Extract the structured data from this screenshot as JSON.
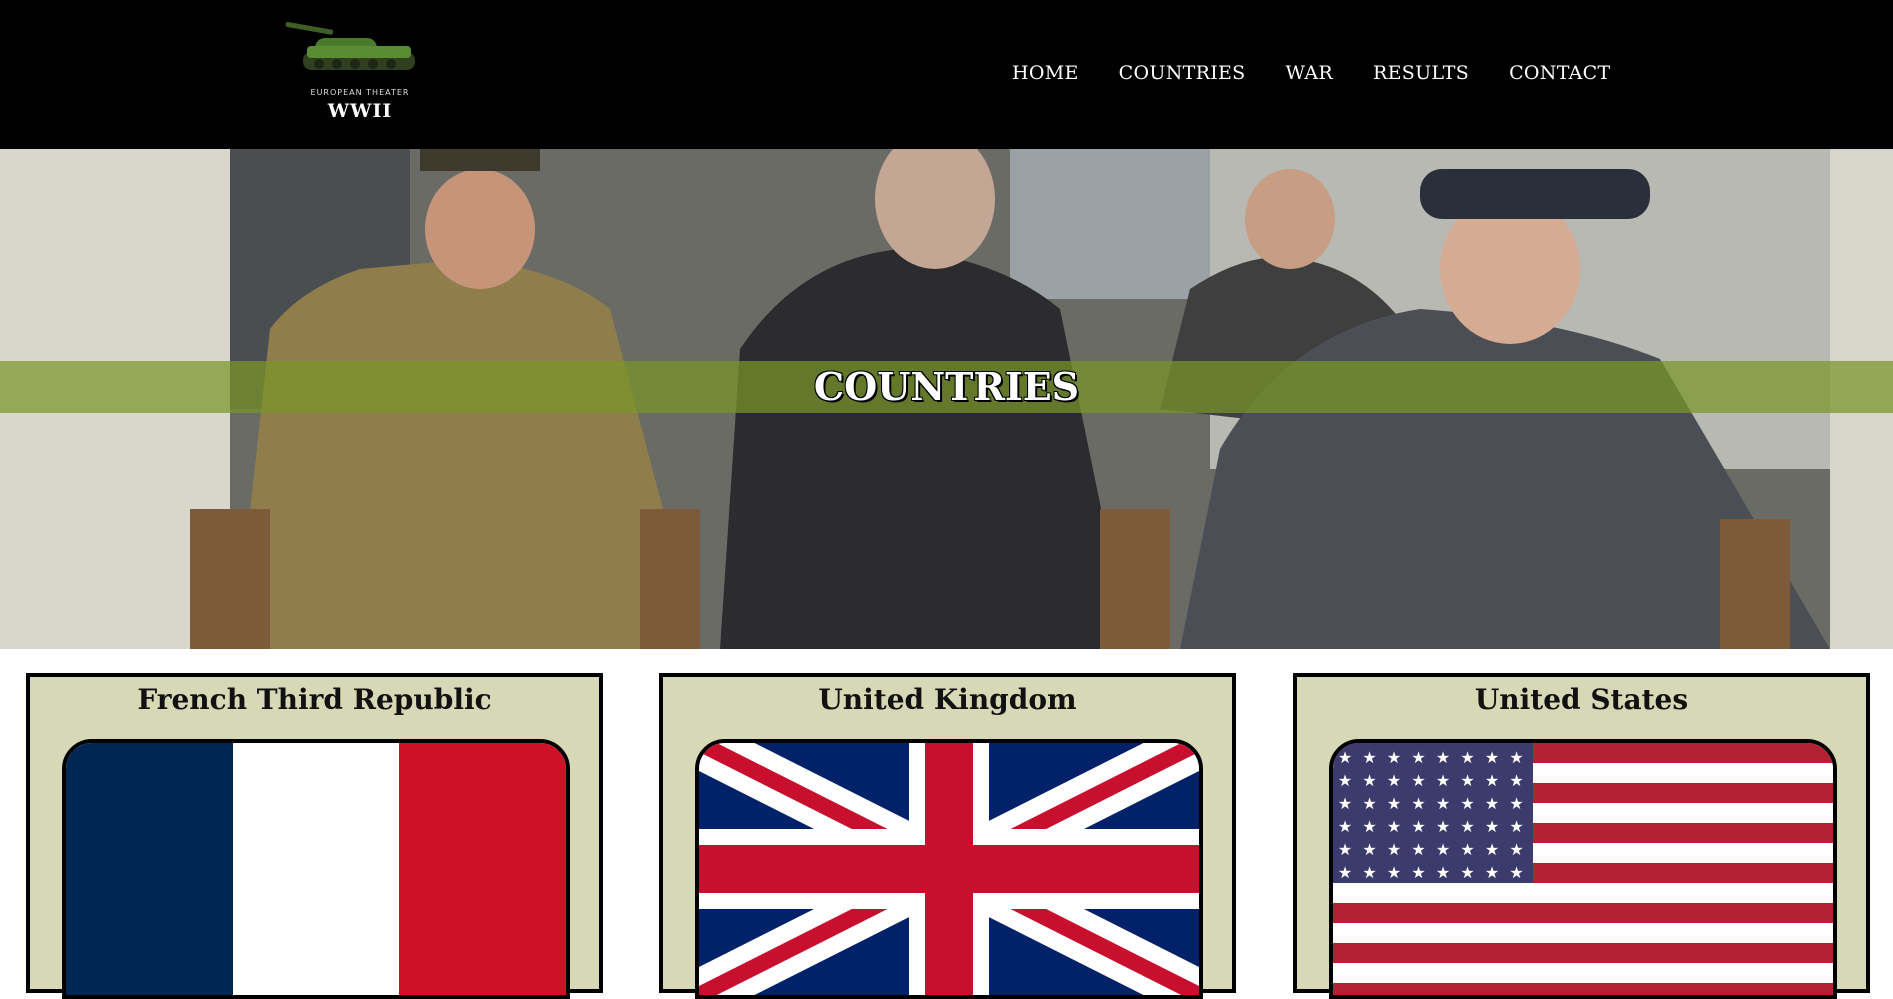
{
  "header": {
    "logo_subtitle": "EUROPEAN THEATER",
    "logo_title": "WWII",
    "nav": [
      {
        "label": "HOME"
      },
      {
        "label": "COUNTRIES"
      },
      {
        "label": "WAR"
      },
      {
        "label": "RESULTS"
      },
      {
        "label": "CONTACT"
      }
    ]
  },
  "hero": {
    "title": "COUNTRIES"
  },
  "countries": [
    {
      "name": "French Third Republic",
      "flag": "france-flag"
    },
    {
      "name": "United Kingdom",
      "flag": "union-jack-flag"
    },
    {
      "name": "United States",
      "flag": "us-48-star-flag"
    }
  ],
  "colors": {
    "header_bg": "#000000",
    "band": "#78962a",
    "card_bg": "#d7d8b5"
  }
}
